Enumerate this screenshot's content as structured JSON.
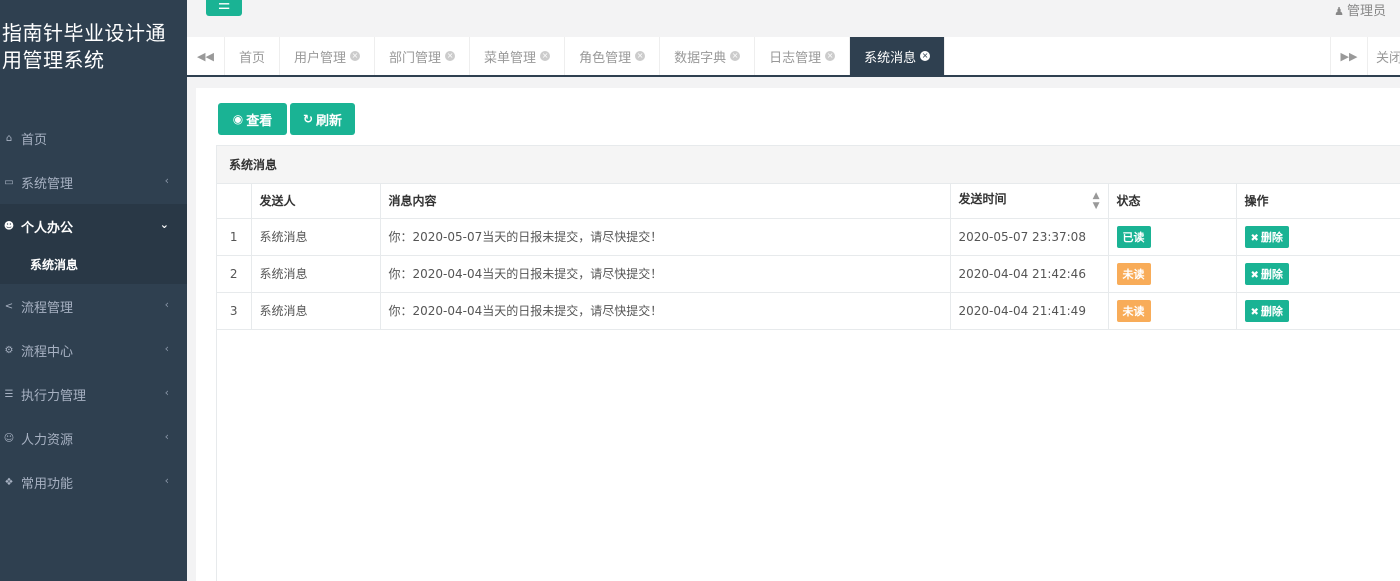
{
  "brand": {
    "line1": "指南针毕业设计通",
    "line2": "用管理系统"
  },
  "topbar": {
    "user_label": "管理员"
  },
  "sidebar": {
    "items": [
      {
        "label": "首页",
        "icon": "home-icon"
      },
      {
        "label": "系统管理",
        "icon": "monitor-icon"
      },
      {
        "label": "个人办公",
        "icon": "users-icon"
      },
      {
        "label": "流程管理",
        "icon": "share-icon"
      },
      {
        "label": "流程中心",
        "icon": "gear-icon"
      },
      {
        "label": "执行力管理",
        "icon": "list-icon"
      },
      {
        "label": "人力资源",
        "icon": "user-plus-icon"
      },
      {
        "label": "常用功能",
        "icon": "cubes-icon"
      }
    ],
    "sub_item": "系统消息"
  },
  "tabs": [
    {
      "label": "首页"
    },
    {
      "label": "用户管理"
    },
    {
      "label": "部门管理"
    },
    {
      "label": "菜单管理"
    },
    {
      "label": "角色管理"
    },
    {
      "label": "数据字典"
    },
    {
      "label": "日志管理"
    },
    {
      "label": "系统消息"
    }
  ],
  "close_tabs_label": "关闭",
  "toolbar": {
    "view_label": "查看",
    "refresh_label": "刷新"
  },
  "panel": {
    "title": "系统消息"
  },
  "table": {
    "headers": [
      "",
      "发送人",
      "消息内容",
      "发送时间",
      "状态",
      "操作"
    ],
    "rows": [
      {
        "index": "1",
        "sender": "系统消息",
        "content": "你：2020-05-07当天的日报未提交，请尽快提交！",
        "time": "2020-05-07 23:37:08",
        "status": "已读",
        "action": "删除"
      },
      {
        "index": "2",
        "sender": "系统消息",
        "content": "你：2020-04-04当天的日报未提交，请尽快提交！",
        "time": "2020-04-04 21:42:46",
        "status": "未读",
        "action": "删除"
      },
      {
        "index": "3",
        "sender": "系统消息",
        "content": "你：2020-04-04当天的日报未提交，请尽快提交！",
        "time": "2020-04-04 21:41:49",
        "status": "未读",
        "action": "删除"
      }
    ]
  },
  "colors": {
    "sidebar_bg": "#2f4050",
    "accent": "#1ab394",
    "warning": "#f8ac59"
  }
}
